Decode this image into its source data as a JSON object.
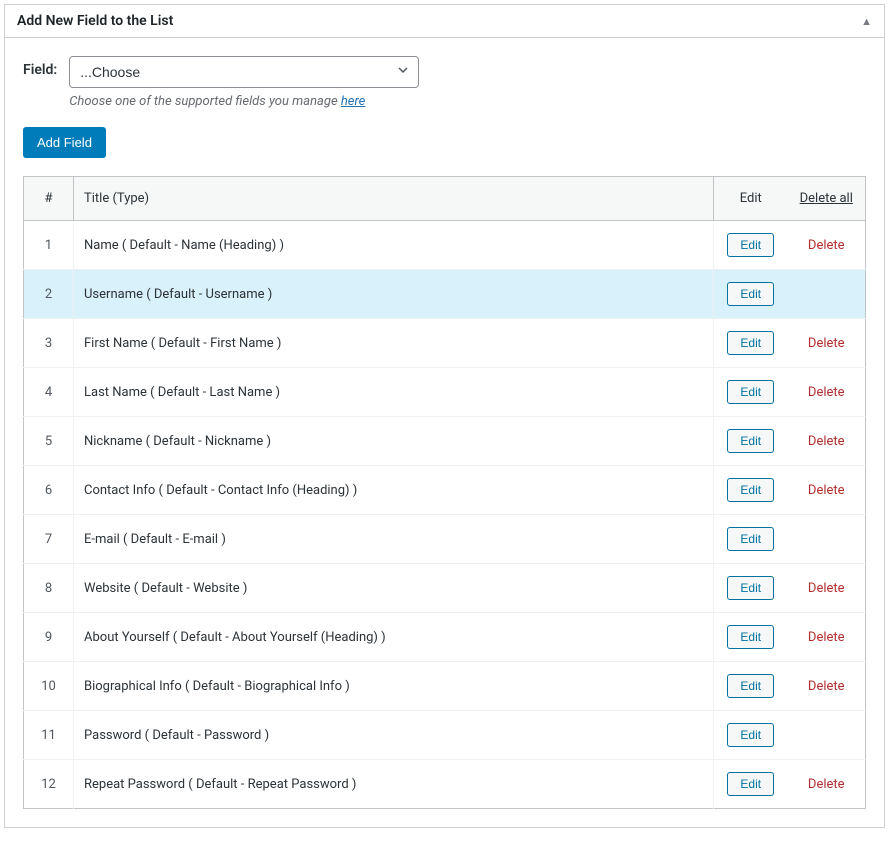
{
  "panel": {
    "title": "Add New Field to the List"
  },
  "field": {
    "label": "Field:",
    "select_value": "...Choose",
    "help_prefix": "Choose one of the supported fields you manage ",
    "help_link": "here"
  },
  "buttons": {
    "add": "Add Field",
    "edit": "Edit"
  },
  "table": {
    "headers": {
      "num": "#",
      "title": "Title (Type)",
      "edit": "Edit",
      "delete": "Delete all"
    },
    "delete_label": "Delete",
    "rows": [
      {
        "num": "1",
        "title": "Name ( Default - Name (Heading) )",
        "deletable": true,
        "highlight": false
      },
      {
        "num": "2",
        "title": "Username ( Default - Username )",
        "deletable": false,
        "highlight": true
      },
      {
        "num": "3",
        "title": "First Name ( Default - First Name )",
        "deletable": true,
        "highlight": false
      },
      {
        "num": "4",
        "title": "Last Name ( Default - Last Name )",
        "deletable": true,
        "highlight": false
      },
      {
        "num": "5",
        "title": "Nickname ( Default - Nickname )",
        "deletable": true,
        "highlight": false
      },
      {
        "num": "6",
        "title": "Contact Info ( Default - Contact Info (Heading) )",
        "deletable": true,
        "highlight": false
      },
      {
        "num": "7",
        "title": "E-mail ( Default - E-mail )",
        "deletable": false,
        "highlight": false
      },
      {
        "num": "8",
        "title": "Website ( Default - Website )",
        "deletable": true,
        "highlight": false
      },
      {
        "num": "9",
        "title": "About Yourself ( Default - About Yourself (Heading) )",
        "deletable": true,
        "highlight": false
      },
      {
        "num": "10",
        "title": "Biographical Info ( Default - Biographical Info )",
        "deletable": true,
        "highlight": false
      },
      {
        "num": "11",
        "title": "Password ( Default - Password )",
        "deletable": false,
        "highlight": false
      },
      {
        "num": "12",
        "title": "Repeat Password ( Default - Repeat Password )",
        "deletable": true,
        "highlight": false
      }
    ]
  }
}
